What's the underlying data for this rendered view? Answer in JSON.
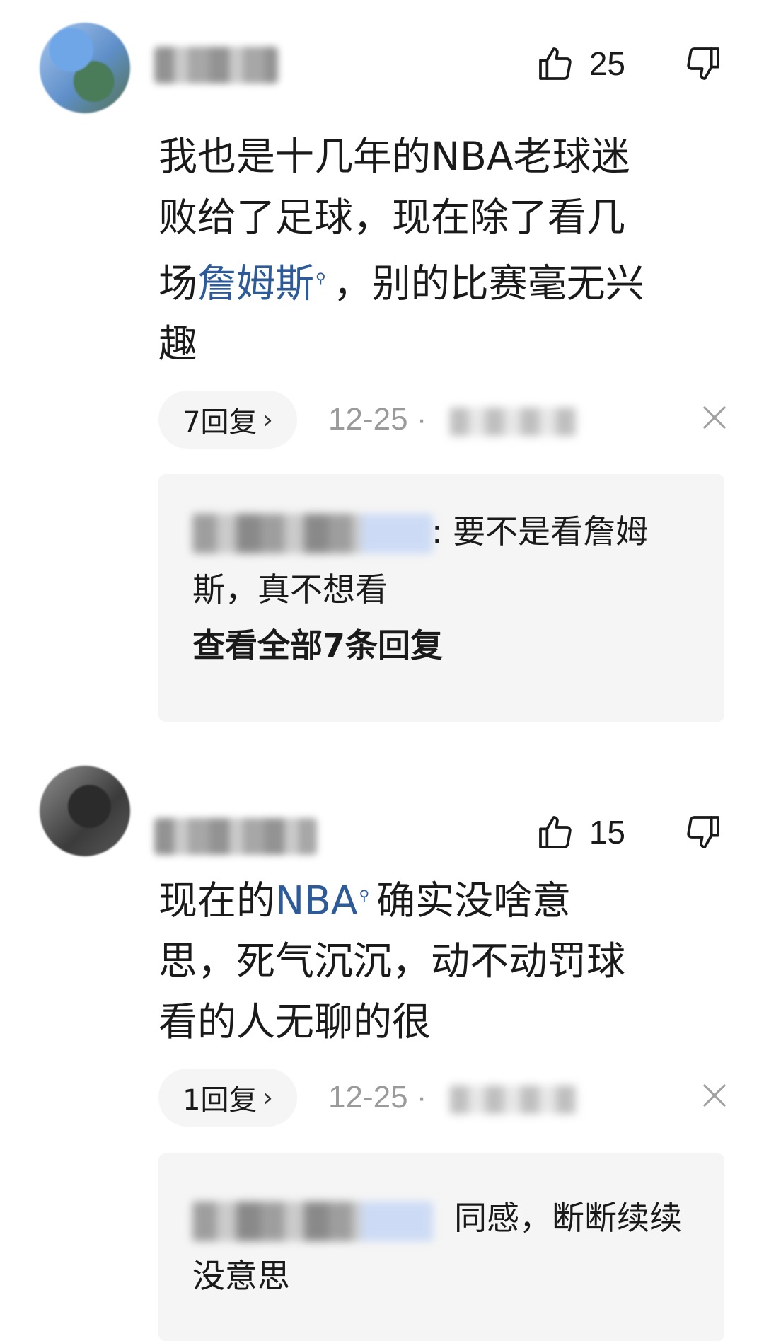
{
  "comments": [
    {
      "likes": "25",
      "text_lines": {
        "line1": "我也是十几年的NBA老球迷",
        "line2": "败给了足球，现在除了看几",
        "line3_pre": "场",
        "line3_link": "詹姆斯",
        "line3_post": "，别的比赛毫无兴",
        "line4": "趣"
      },
      "reply_pill": "7回复",
      "timestamp": "12-25 ·",
      "reply_preview": ": 要不是看詹姆斯，真不想看",
      "view_all": "查看全部7条回复"
    },
    {
      "likes": "15",
      "text_lines": {
        "line1_pre": "现在的",
        "line1_link": "NBA",
        "line1_post": "确实没啥意",
        "line2": "思，死气沉沉，动不动罚球",
        "line3": "看的人无聊的很"
      },
      "reply_pill": "1回复",
      "timestamp": "12-25 ·",
      "reply_preview": "同感，断断续续没意思"
    }
  ],
  "icons": {
    "like": "thumbs-up-outline",
    "dislike": "thumbs-down-outline",
    "close": "x-close",
    "chevron": "chevron-right",
    "search": "search-magnifier"
  },
  "colors": {
    "link": "#2d5b9a",
    "muted": "#9a9a9a",
    "reply_bg": "#f5f5f5"
  }
}
